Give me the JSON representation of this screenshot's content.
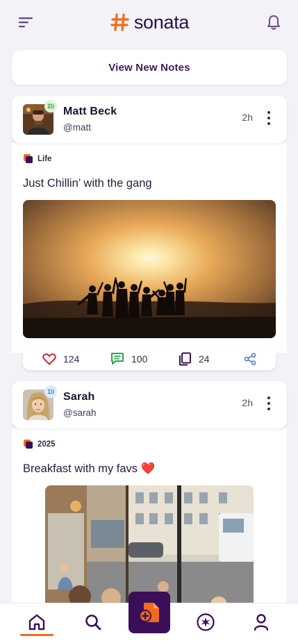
{
  "app": {
    "name": "sonata",
    "brand_color": "#f26a1b",
    "primary_color": "#3a0f5a"
  },
  "header": {
    "menu_icon": "menu-icon",
    "notification_icon": "bell-icon"
  },
  "feed": {
    "view_new_label": "View New Notes"
  },
  "posts": [
    {
      "name": "Matt Beck",
      "handle": "@matt",
      "time": "2h",
      "badge": "2",
      "badge_color": "#5ac85a",
      "tag": "Life",
      "caption": "Just Chillin’ with the gang",
      "likes": "124",
      "comments": "100",
      "copies": "24"
    },
    {
      "name": "Sarah",
      "handle": "@sarah",
      "time": "2h",
      "badge": "1",
      "badge_color": "#5aa8e8",
      "tag": "2025",
      "caption": "Breakfast with my favs ❤️"
    }
  ],
  "bottom_nav": {
    "items": [
      "home-icon",
      "search-icon",
      "create-note-icon",
      "explore-icon",
      "profile-icon"
    ],
    "active": "home-icon"
  }
}
